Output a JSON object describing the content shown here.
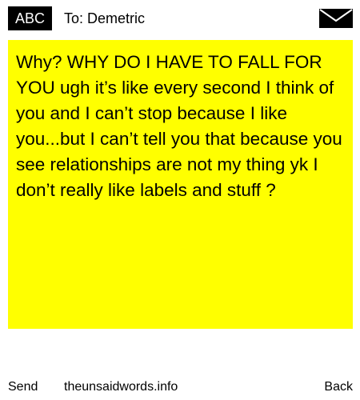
{
  "header": {
    "badge_label": "ABC",
    "to_label": "To: Demetric",
    "icon": "envelope-icon"
  },
  "message": {
    "text": "Why? WHY DO I HAVE TO FALL FOR YOU ugh it’s like every second I think of you and I can’t stop because I like you...but I can’t tell you that because you see relationships are not my thing yk I don’t really like labels and stuff ?"
  },
  "footer": {
    "send_label": "Send",
    "site_label": "theunsaidwords.info",
    "back_label": "Back"
  },
  "colors": {
    "message_background": "#ffff00",
    "badge_background": "#000000",
    "badge_text": "#ffffff",
    "page_background": "#ffffff"
  }
}
